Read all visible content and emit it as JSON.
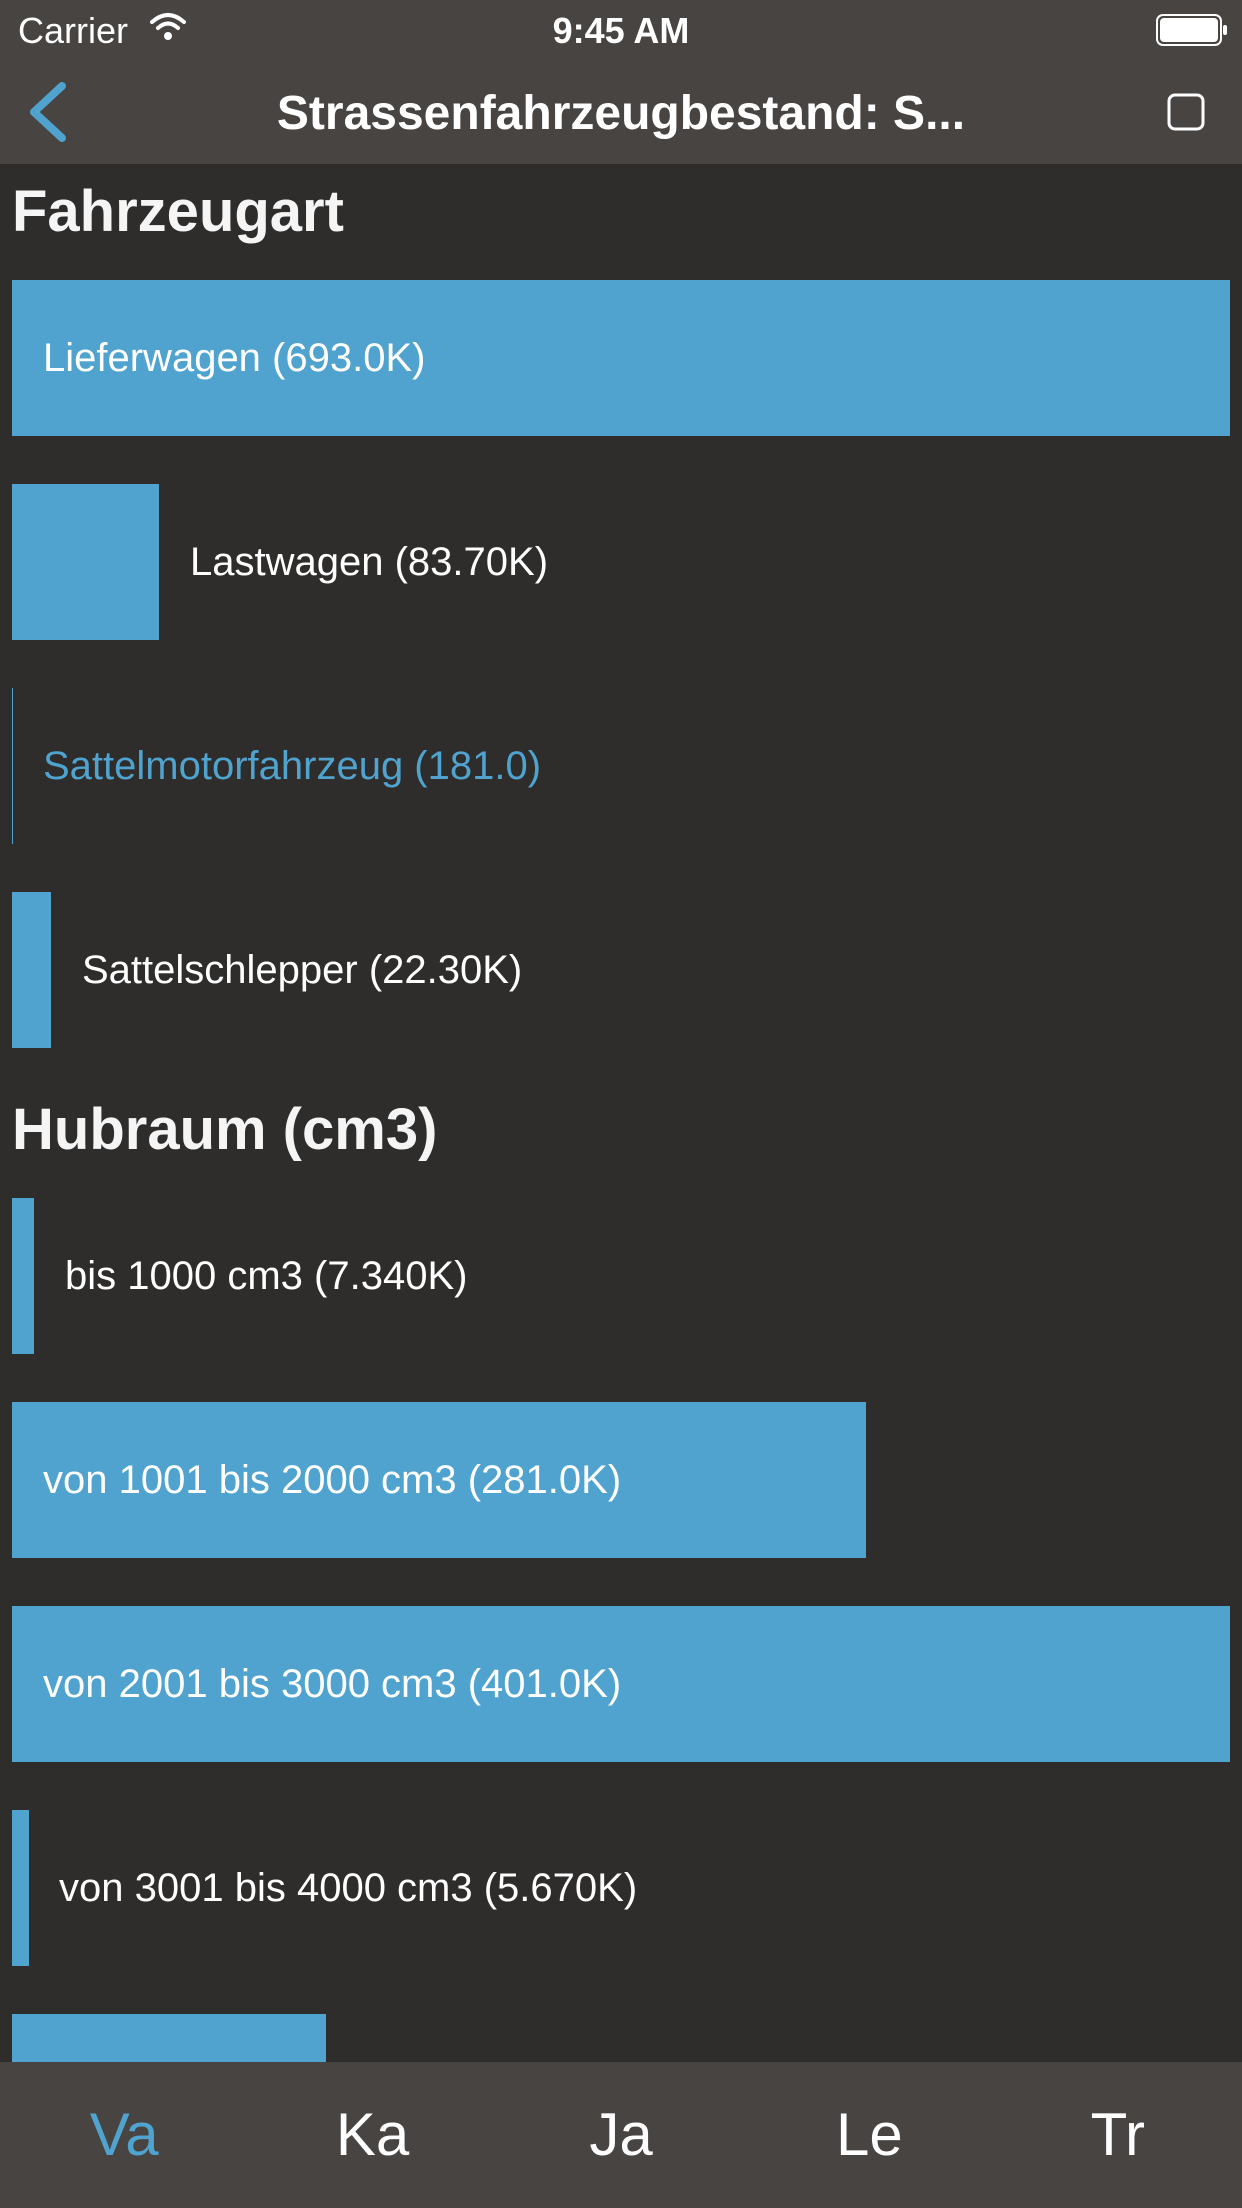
{
  "status_bar": {
    "carrier": "Carrier",
    "time": "9:45 AM"
  },
  "nav": {
    "title": "Strassenfahrzeugbestand: S...",
    "back_icon": "chevron-left-icon",
    "action_icon": "square-icon"
  },
  "colors": {
    "accent": "#4fa3ce",
    "background": "#2e2d2c",
    "bars_chrome": "#474442"
  },
  "sections": [
    {
      "title": "Fahrzeugart",
      "bars": [
        {
          "label": "Lieferwagen (693.0K)",
          "value": 693000,
          "fraction": 1.0,
          "label_style": "inside"
        },
        {
          "label": "Lastwagen (83.70K)",
          "value": 83700,
          "fraction": 0.121,
          "label_style": "outside"
        },
        {
          "label": "Sattelmotorfahrzeug (181.0)",
          "value": 181,
          "fraction": 0.0003,
          "label_style": "accent"
        },
        {
          "label": "Sattelschlepper (22.30K)",
          "value": 22300,
          "fraction": 0.032,
          "label_style": "outside"
        }
      ]
    },
    {
      "title": "Hubraum (cm3)",
      "bars": [
        {
          "label": "bis 1000 cm3 (7.340K)",
          "value": 7340,
          "fraction": 0.018,
          "label_style": "outside"
        },
        {
          "label": "von 1001 bis 2000 cm3 (281.0K)",
          "value": 281000,
          "fraction": 0.701,
          "label_style": "inside"
        },
        {
          "label": "von 2001 bis 3000 cm3 (401.0K)",
          "value": 401000,
          "fraction": 1.0,
          "label_style": "inside"
        },
        {
          "label": "von 3001 bis 4000 cm3 (5.670K)",
          "value": 5670,
          "fraction": 0.014,
          "label_style": "outside"
        },
        {
          "label": "",
          "value": null,
          "fraction": 0.258,
          "label_style": "inside"
        }
      ]
    }
  ],
  "tabs": [
    {
      "label": "Va",
      "active": true
    },
    {
      "label": "Ka",
      "active": false
    },
    {
      "label": "Ja",
      "active": false
    },
    {
      "label": "Le",
      "active": false
    },
    {
      "label": "Tr",
      "active": false
    }
  ]
}
